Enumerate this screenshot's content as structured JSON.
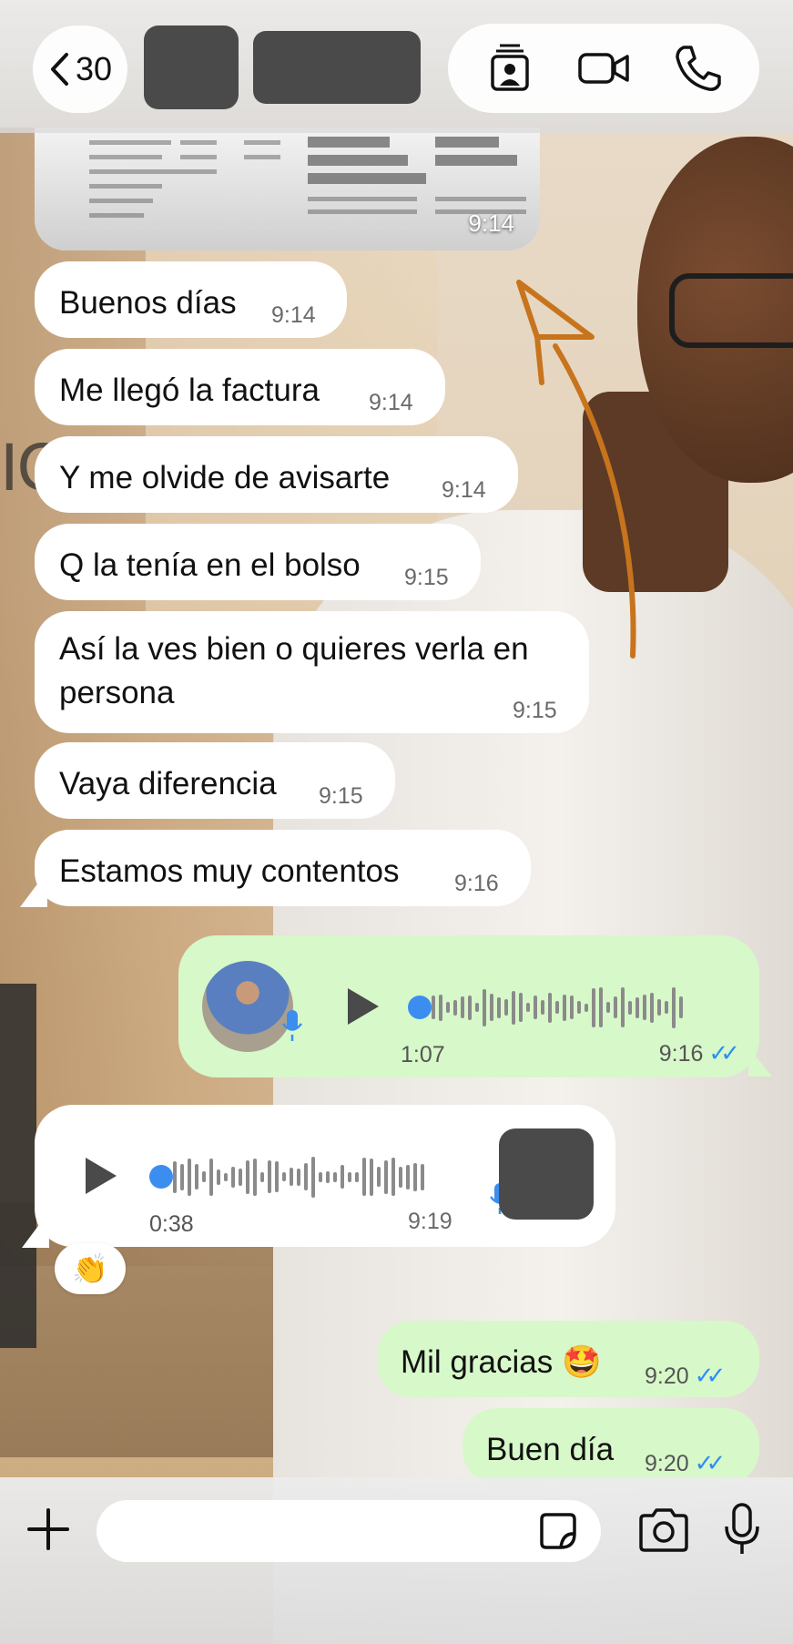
{
  "header": {
    "back_count": "30"
  },
  "messages": {
    "image_time": "9:14",
    "m1": {
      "text": "Buenos días",
      "time": "9:14"
    },
    "m2": {
      "text": "Me llegó la factura",
      "time": "9:14"
    },
    "m3": {
      "text": "Y me olvide de avisarte",
      "time": "9:14"
    },
    "m4": {
      "text": "Q la tenía en el bolso",
      "time": "9:15"
    },
    "m5": {
      "line1": "Así la ves bien o quieres verla en",
      "line2": "persona",
      "time": "9:15"
    },
    "m6": {
      "text": "Vaya diferencia",
      "time": "9:15"
    },
    "m7": {
      "text": "Estamos muy contentos",
      "time": "9:16"
    },
    "voice_out": {
      "duration": "1:07",
      "time": "9:16",
      "progress": 0
    },
    "voice_in": {
      "duration": "0:38",
      "time": "9:19",
      "progress": 0,
      "reaction": "👏"
    },
    "m8": {
      "text": "Mil gracias",
      "emoji": "🤩",
      "time": "9:20"
    },
    "m9": {
      "text": "Buen día",
      "time": "9:20"
    }
  },
  "composer": {
    "placeholder": ""
  },
  "colors": {
    "incoming_bubble": "#ffffff",
    "outgoing_bubble": "#d7f8c9",
    "read_ticks": "#2f8ef5",
    "voice_dot": "#3b8ef0"
  },
  "icons": {
    "back": "chevron-left-icon",
    "contact_card": "contact-card-icon",
    "video": "video-camera-icon",
    "phone": "phone-icon",
    "plus": "plus-icon",
    "sticker": "sticker-icon",
    "camera": "camera-icon",
    "mic": "microphone-icon",
    "play": "play-icon"
  }
}
